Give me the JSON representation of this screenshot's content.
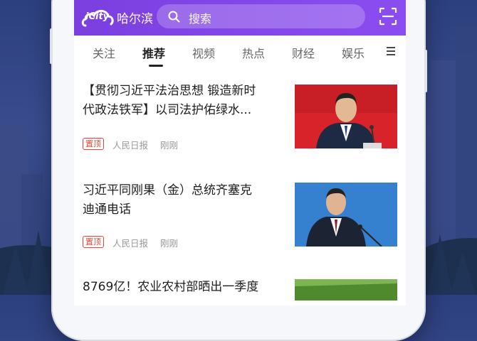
{
  "app": {
    "logo_text": "iCity",
    "city": "哈尔滨",
    "search_placeholder": "搜索"
  },
  "tabs": [
    {
      "label": "关注",
      "active": false
    },
    {
      "label": "推荐",
      "active": true
    },
    {
      "label": "视频",
      "active": false
    },
    {
      "label": "热点",
      "active": false
    },
    {
      "label": "财经",
      "active": false
    },
    {
      "label": "娱乐",
      "active": false
    }
  ],
  "icons": {
    "search": "search-icon",
    "scan": "scan-icon",
    "menu": "menu-icon",
    "logo_cloud": "cloud-logo-icon"
  },
  "feed": [
    {
      "title_line1": "【贯彻习近平法治思想 锻造新时",
      "title_line2": "代政法铁军】以司法护佑绿水...",
      "tag": "置顶",
      "source": "人民日报",
      "time": "刚刚"
    },
    {
      "title_line1": "习近平同刚果（金）总统齐塞克",
      "title_line2": "迪通电话",
      "tag": "置顶",
      "source": "人民日报",
      "time": "刚刚"
    },
    {
      "title_line1": "8769亿！农业农村部晒出一季度",
      "title_line2": "",
      "tag": "",
      "source": "",
      "time": ""
    }
  ],
  "colors": {
    "brand_purple": "#7b3fe0",
    "tag_red": "#e2453c"
  }
}
